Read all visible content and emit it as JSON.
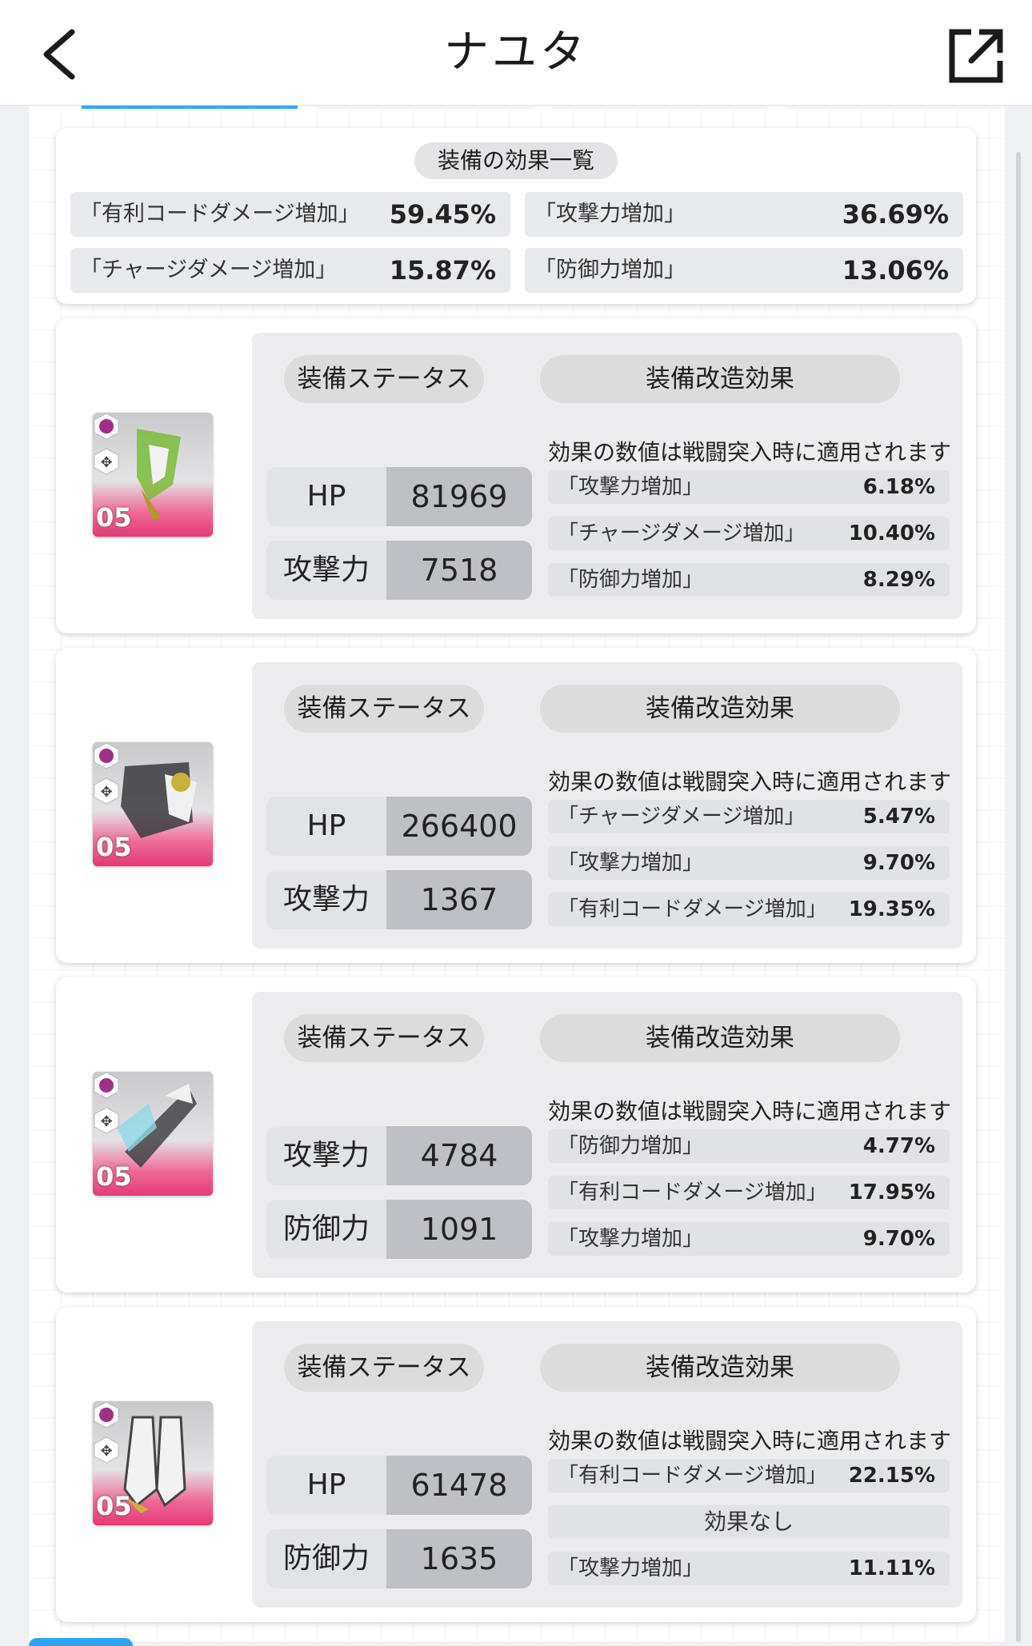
{
  "header": {
    "title": "ナユタ"
  },
  "summary": {
    "heading": "装備の効果一覧",
    "effects": [
      {
        "name": "「有利コードダメージ増加」",
        "value": "59.45%"
      },
      {
        "name": "「攻撃力増加」",
        "value": "36.69%"
      },
      {
        "name": "「チャージダメージ増加」",
        "value": "15.87%"
      },
      {
        "name": "「防御力増加」",
        "value": "13.06%"
      }
    ]
  },
  "equipment": [
    {
      "level": "05",
      "status_heading": "装備ステータス",
      "mod_heading": "装備改造効果",
      "note": "効果の数値は戦闘突入時に適用されます",
      "stats": [
        {
          "label": "HP",
          "value": "81969"
        },
        {
          "label": "攻撃力",
          "value": "7518"
        }
      ],
      "mods": [
        {
          "name": "「攻撃力増加」",
          "value": "6.18%"
        },
        {
          "name": "「チャージダメージ増加」",
          "value": "10.40%"
        },
        {
          "name": "「防御力増加」",
          "value": "8.29%"
        }
      ]
    },
    {
      "level": "05",
      "status_heading": "装備ステータス",
      "mod_heading": "装備改造効果",
      "note": "効果の数値は戦闘突入時に適用されます",
      "stats": [
        {
          "label": "HP",
          "value": "266400"
        },
        {
          "label": "攻撃力",
          "value": "1367"
        }
      ],
      "mods": [
        {
          "name": "「チャージダメージ増加」",
          "value": "5.47%"
        },
        {
          "name": "「攻撃力増加」",
          "value": "9.70%"
        },
        {
          "name": "「有利コードダメージ増加」",
          "value": "19.35%"
        }
      ]
    },
    {
      "level": "05",
      "status_heading": "装備ステータス",
      "mod_heading": "装備改造効果",
      "note": "効果の数値は戦闘突入時に適用されます",
      "stats": [
        {
          "label": "攻撃力",
          "value": "4784"
        },
        {
          "label": "防御力",
          "value": "1091"
        }
      ],
      "mods": [
        {
          "name": "「防御力増加」",
          "value": "4.77%"
        },
        {
          "name": "「有利コードダメージ増加」",
          "value": "17.95%"
        },
        {
          "name": "「攻撃力増加」",
          "value": "9.70%"
        }
      ]
    },
    {
      "level": "05",
      "status_heading": "装備ステータス",
      "mod_heading": "装備改造効果",
      "note": "効果の数値は戦闘突入時に適用されます",
      "stats": [
        {
          "label": "HP",
          "value": "61478"
        },
        {
          "label": "防御力",
          "value": "1635"
        }
      ],
      "mods": [
        {
          "name": "「有利コードダメージ増加」",
          "value": "22.15%"
        },
        {
          "name": "",
          "value": "",
          "text": "効果なし"
        },
        {
          "name": "「攻撃力増加」",
          "value": "11.11%"
        }
      ]
    }
  ],
  "icons": {
    "back": "chevron-left-icon",
    "share": "external-link-icon",
    "equip_class": "hex-badge-icon",
    "equip_type": "gear-icon"
  },
  "colors": {
    "accent": "#3aa6e8",
    "pink": "#e53977"
  }
}
